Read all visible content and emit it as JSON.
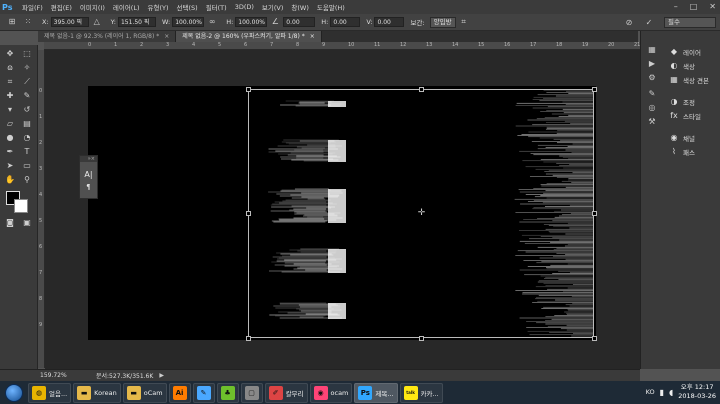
{
  "menubar": {
    "logo": "Ps",
    "items": [
      "파일(F)",
      "편집(E)",
      "이미지(I)",
      "레이어(L)",
      "유형(Y)",
      "선택(S)",
      "필터(T)",
      "3D(D)",
      "보기(V)",
      "창(W)",
      "도움말(H)"
    ],
    "window_controls": [
      "–",
      "□",
      "✕"
    ]
  },
  "options": {
    "x_label": "X:",
    "x_value": "395.00 픽",
    "y_label": "Y:",
    "y_value": "151.50 픽",
    "w_label": "W:",
    "w_value": "100.00%",
    "h_label": "H:",
    "h_value": "100.00%",
    "angle_value": "0.00",
    "hskew_label": "H:",
    "hskew_value": "0.00",
    "vskew_label": "V:",
    "vskew_value": "0.00",
    "interp_label": "보간:",
    "interp_value": "양입방",
    "workspace": "필수"
  },
  "tabs": [
    {
      "label": "제목 없음-1 @ 92.3% (레이어 1, RGB/8) *",
      "close": "×"
    },
    {
      "label": "제목 없음-2 @ 160% (우파스켜기, 알파 1/8) *",
      "close": "×"
    }
  ],
  "ruler_top": [
    "0",
    "1",
    "2",
    "3",
    "4",
    "5",
    "6",
    "7",
    "8",
    "9",
    "10",
    "11",
    "12",
    "13",
    "14",
    "15",
    "16",
    "17",
    "18",
    "19",
    "20",
    "21",
    "22"
  ],
  "ruler_left": [
    "0",
    "1",
    "2",
    "3",
    "4",
    "5",
    "6",
    "7",
    "8",
    "9"
  ],
  "char_panel": {
    "icon_a": "A|",
    "icon_b": "¶"
  },
  "right_panel": [
    {
      "icon": "layers",
      "label": "레이어"
    },
    {
      "icon": "color",
      "label": "색상"
    },
    {
      "icon": "swatches",
      "label": "색상 견본"
    },
    {
      "icon": "adjust",
      "label": "조정"
    },
    {
      "icon": "styles",
      "label": "스타일"
    },
    {
      "icon": "channels",
      "label": "채널"
    },
    {
      "icon": "paths",
      "label": "패스"
    }
  ],
  "status": {
    "zoom": "159.72%",
    "doc": "문서:527.3K/351.6K"
  },
  "taskbar": {
    "items": [
      {
        "label": "얼음...",
        "icon": "chrome",
        "color": "#e8b400"
      },
      {
        "label": "Korean",
        "icon": "folder",
        "color": "#e6b94a"
      },
      {
        "label": "oCam",
        "icon": "folder",
        "color": "#e6b94a"
      },
      {
        "label": "",
        "icon": "illustrator",
        "color": "#ff7c00"
      },
      {
        "label": "",
        "icon": "edit",
        "color": "#4aa8ff"
      },
      {
        "label": "",
        "icon": "evernote",
        "color": "#6ec02c"
      },
      {
        "label": "",
        "icon": "app",
        "color": "#888"
      },
      {
        "label": "칼무리",
        "icon": "pencil",
        "color": "#d44"
      },
      {
        "label": "ocam",
        "icon": "ocam",
        "color": "#f47"
      },
      {
        "label": "제목...",
        "icon": "photoshop",
        "color": "#31a8ff",
        "active": true
      },
      {
        "label": "카카...",
        "icon": "kakao",
        "color": "#ffe812"
      }
    ],
    "lang": "KO",
    "time": "오후 12:17",
    "date": "2018-03-26"
  },
  "colors": {
    "accent": "#31a8ff",
    "canvas": "#000000",
    "workspace": "#282828"
  }
}
